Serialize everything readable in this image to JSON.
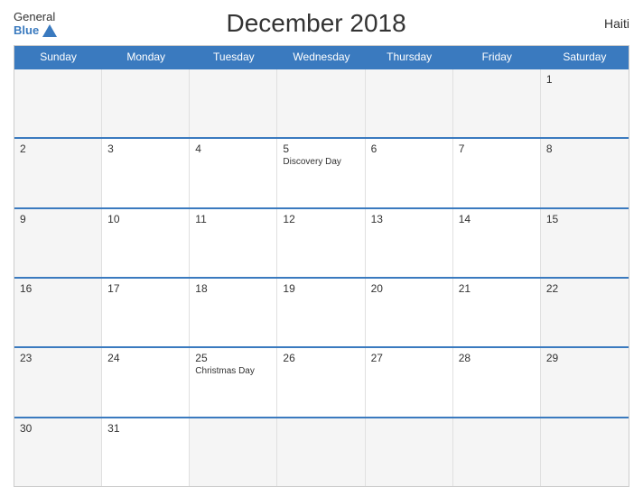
{
  "logo": {
    "general": "General",
    "blue": "Blue"
  },
  "title": "December 2018",
  "country": "Haiti",
  "header_days": [
    "Sunday",
    "Monday",
    "Tuesday",
    "Wednesday",
    "Thursday",
    "Friday",
    "Saturday"
  ],
  "weeks": [
    [
      {
        "day": "",
        "empty": true
      },
      {
        "day": "",
        "empty": true
      },
      {
        "day": "",
        "empty": true
      },
      {
        "day": "",
        "empty": true
      },
      {
        "day": "",
        "empty": true
      },
      {
        "day": "",
        "empty": true
      },
      {
        "day": "1",
        "weekend": true
      }
    ],
    [
      {
        "day": "2",
        "weekend": true
      },
      {
        "day": "3"
      },
      {
        "day": "4"
      },
      {
        "day": "5",
        "holiday": "Discovery Day"
      },
      {
        "day": "6"
      },
      {
        "day": "7"
      },
      {
        "day": "8",
        "weekend": true
      }
    ],
    [
      {
        "day": "9",
        "weekend": true
      },
      {
        "day": "10"
      },
      {
        "day": "11"
      },
      {
        "day": "12"
      },
      {
        "day": "13"
      },
      {
        "day": "14"
      },
      {
        "day": "15",
        "weekend": true
      }
    ],
    [
      {
        "day": "16",
        "weekend": true
      },
      {
        "day": "17"
      },
      {
        "day": "18"
      },
      {
        "day": "19"
      },
      {
        "day": "20"
      },
      {
        "day": "21"
      },
      {
        "day": "22",
        "weekend": true
      }
    ],
    [
      {
        "day": "23",
        "weekend": true
      },
      {
        "day": "24"
      },
      {
        "day": "25",
        "holiday": "Christmas Day"
      },
      {
        "day": "26"
      },
      {
        "day": "27"
      },
      {
        "day": "28"
      },
      {
        "day": "29",
        "weekend": true
      }
    ],
    [
      {
        "day": "30",
        "weekend": true
      },
      {
        "day": "31"
      },
      {
        "day": "",
        "empty": true
      },
      {
        "day": "",
        "empty": true
      },
      {
        "day": "",
        "empty": true
      },
      {
        "day": "",
        "empty": true
      },
      {
        "day": "",
        "empty": true
      }
    ]
  ]
}
